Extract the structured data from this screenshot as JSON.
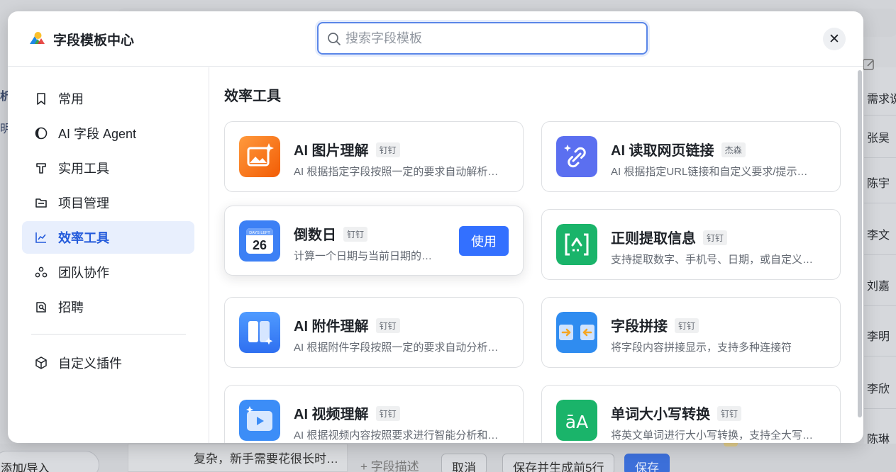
{
  "background": {
    "left_texts": [
      "析",
      "明"
    ],
    "right_column_header": "需求说",
    "right_column_people": [
      "张昊",
      "陈宇",
      "李文",
      "刘嘉",
      "李明",
      "李欣",
      "陈琳"
    ],
    "add_import": "添加/导入",
    "row_text": "复杂，新手需要花很长时…",
    "add_field_desc": "+ 字段描述",
    "cancel": "取消",
    "save_generate": "保存并生成前5行",
    "save": "保存"
  },
  "modal": {
    "title": "字段模板中心",
    "search_placeholder": "搜索字段模板",
    "search_value": "",
    "close_glyph": "✕"
  },
  "sidebar": {
    "items": [
      {
        "label": "常用",
        "icon": "bookmark-icon"
      },
      {
        "label": "AI 字段 Agent",
        "icon": "ai-agent-icon"
      },
      {
        "label": "实用工具",
        "icon": "tool-icon"
      },
      {
        "label": "项目管理",
        "icon": "folder-icon"
      },
      {
        "label": "效率工具",
        "icon": "chart-line-icon",
        "active": true
      },
      {
        "label": "团队协作",
        "icon": "team-icon"
      },
      {
        "label": "招聘",
        "icon": "recruit-icon"
      }
    ],
    "custom_plugin": {
      "label": "自定义插件",
      "icon": "cube-icon"
    }
  },
  "content": {
    "section_title": "效率工具",
    "use_button": "使用",
    "cards": [
      {
        "name": "AI 图片理解",
        "tag": "钉钉",
        "desc": "AI 根据指定字段按照一定的要求自动解析…",
        "icon": "image-ai-icon",
        "color": "#f7761e"
      },
      {
        "name": "AI 读取网页链接",
        "tag": "杰森",
        "desc": "AI 根据指定URL链接和自定义要求/提示…",
        "icon": "link-ai-icon",
        "color": "#5b6ff0"
      },
      {
        "name": "倒数日",
        "tag": "钉钉",
        "desc": "计算一个日期与当前日期的…",
        "icon": "calendar-icon",
        "color": "#3c80f5",
        "calendar_top": "DAYS LEFT",
        "calendar_num": "26"
      },
      {
        "name": "正则提取信息",
        "tag": "钉钉",
        "desc": "支持提取数字、手机号、日期，或自定义…",
        "icon": "regex-icon",
        "color": "#1ab46a"
      },
      {
        "name": "AI 附件理解",
        "tag": "钉钉",
        "desc": "AI 根据附件字段按照一定的要求自动分析…",
        "icon": "attachment-ai-icon",
        "color": "#3b82f6"
      },
      {
        "name": "字段拼接",
        "tag": "钉钉",
        "desc": "将字段内容拼接显示，支持多种连接符",
        "icon": "merge-icon",
        "color": "#2f8cf0"
      },
      {
        "name": "AI 视频理解",
        "tag": "钉钉",
        "desc": "AI 根据视频内容按照要求进行智能分析和…",
        "icon": "video-ai-icon",
        "color": "#3c8df7"
      },
      {
        "name": "单词大小写转换",
        "tag": "钉钉",
        "desc": "将英文单词进行大小写转换，支持全大写…",
        "icon": "case-convert-icon",
        "color": "#1ab46a",
        "glyph": "āA"
      }
    ]
  }
}
